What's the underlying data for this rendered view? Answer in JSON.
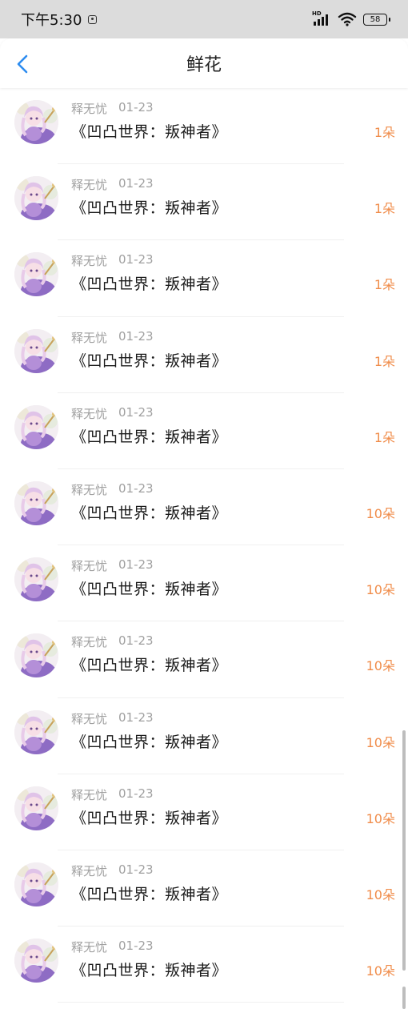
{
  "status_bar": {
    "time": "下午5:30",
    "network": "HD",
    "battery": "58"
  },
  "header": {
    "title": "鲜花"
  },
  "items": [
    {
      "user": "释无忧",
      "date": "01-23",
      "title": "《凹凸世界：叛神者》",
      "count": "1朵"
    },
    {
      "user": "释无忧",
      "date": "01-23",
      "title": "《凹凸世界：叛神者》",
      "count": "1朵"
    },
    {
      "user": "释无忧",
      "date": "01-23",
      "title": "《凹凸世界：叛神者》",
      "count": "1朵"
    },
    {
      "user": "释无忧",
      "date": "01-23",
      "title": "《凹凸世界：叛神者》",
      "count": "1朵"
    },
    {
      "user": "释无忧",
      "date": "01-23",
      "title": "《凹凸世界：叛神者》",
      "count": "1朵"
    },
    {
      "user": "释无忧",
      "date": "01-23",
      "title": "《凹凸世界：叛神者》",
      "count": "10朵"
    },
    {
      "user": "释无忧",
      "date": "01-23",
      "title": "《凹凸世界：叛神者》",
      "count": "10朵"
    },
    {
      "user": "释无忧",
      "date": "01-23",
      "title": "《凹凸世界：叛神者》",
      "count": "10朵"
    },
    {
      "user": "释无忧",
      "date": "01-23",
      "title": "《凹凸世界：叛神者》",
      "count": "10朵"
    },
    {
      "user": "释无忧",
      "date": "01-23",
      "title": "《凹凸世界：叛神者》",
      "count": "10朵"
    },
    {
      "user": "释无忧",
      "date": "01-23",
      "title": "《凹凸世界：叛神者》",
      "count": "10朵"
    },
    {
      "user": "释无忧",
      "date": "01-23",
      "title": "《凹凸世界：叛神者》",
      "count": "10朵"
    }
  ],
  "colors": {
    "accent": "#2d8cf0",
    "count": "#f08c4a",
    "meta": "#a0a0a0",
    "status_bar_bg": "#dcdcdc"
  },
  "icons": {
    "back": "chevron-left-icon",
    "wifi": "wifi-icon",
    "signal": "signal-icon",
    "battery": "battery-icon",
    "notification": "notification-icon"
  }
}
